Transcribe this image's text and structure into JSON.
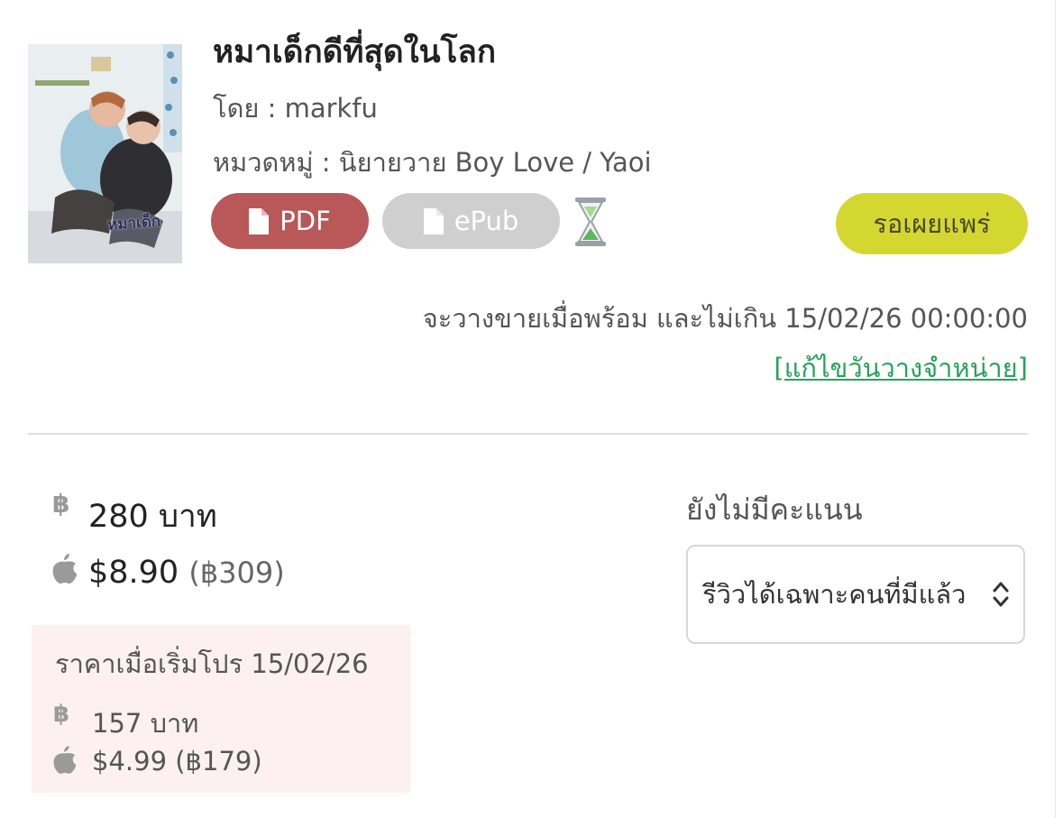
{
  "book": {
    "title": "หมาเด็กดีที่สุดในโลก",
    "author": "โดย : markfu",
    "category": "หมวดหมู่ : นิยายวาย Boy Love / Yaoi",
    "cover_text": "หมาเด็ก"
  },
  "formats": {
    "pdf_label": "PDF",
    "epub_label": "ePub",
    "pdf_color": "#b85858",
    "epub_color": "#cfcfcf",
    "pending_icon": "hourglass-icon"
  },
  "status": {
    "label": "รอเผยแพร่",
    "color": "#d5d731"
  },
  "release": {
    "note": "จะวางขายเมื่อพร้อม และไม่เกิน 15/02/26 00:00:00",
    "edit_link": "[แก้ไขวันวางจำหน่าย]",
    "link_color": "#27a35a"
  },
  "pricing": {
    "baht_symbol": "฿",
    "baht_price": "280 บาท",
    "usd_price": "$8.90",
    "usd_in_baht": "(฿309)"
  },
  "promo": {
    "title": "ราคาเมื่อเริ่มโปร 15/02/26",
    "baht_price": "157 บาท",
    "usd_price": "$4.99 (฿179)",
    "background": "#fdf0f0"
  },
  "rating": {
    "text": "ยังไม่มีคะแนน",
    "review_option": "รีวิวได้เฉพาะคนที่มีแล้ว"
  }
}
